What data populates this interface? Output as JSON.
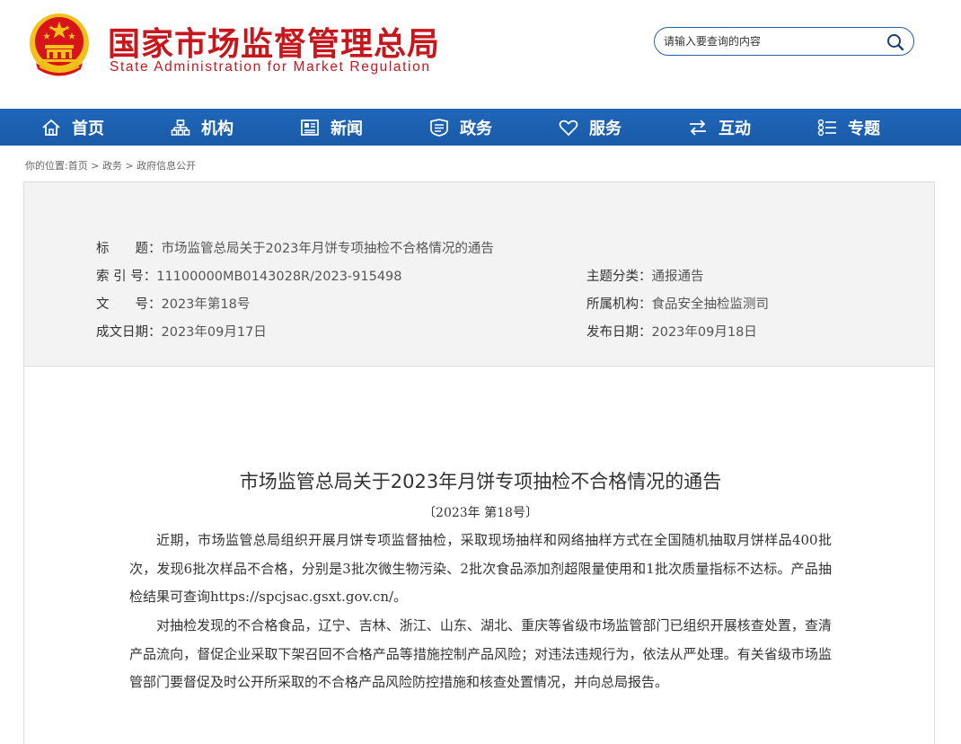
{
  "header": {
    "title_cn": "国家市场监督管理总局",
    "title_en": "State Administration for Market Regulation",
    "emblem_icon": "national-emblem-icon",
    "search_placeholder": "请输入要查询的内容",
    "search_icon": "search-icon"
  },
  "nav": {
    "items": [
      {
        "label": "首页",
        "icon": "home-icon"
      },
      {
        "label": "机构",
        "icon": "org-icon"
      },
      {
        "label": "新闻",
        "icon": "news-icon"
      },
      {
        "label": "政务",
        "icon": "affairs-icon"
      },
      {
        "label": "服务",
        "icon": "heart-icon"
      },
      {
        "label": "互动",
        "icon": "exchange-icon"
      },
      {
        "label": "专题",
        "icon": "topics-icon"
      }
    ]
  },
  "breadcrumb": {
    "prefix": "你的位置:",
    "items": [
      "首页",
      "政务",
      "政府信息公开"
    ],
    "separator": ">"
  },
  "meta": {
    "title_label": "标　　题：",
    "title_value": "市场监管总局关于2023年月饼专项抽检不合格情况的通告",
    "index_label": "索 引 号：",
    "index_value": "11100000MB0143028R/2023-915498",
    "topic_label": "主题分类：",
    "topic_value": "通报通告",
    "docno_label": "文　　号：",
    "docno_value": "2023年第18号",
    "org_label": "所属机构：",
    "org_value": "食品安全抽检监测司",
    "created_label": "成文日期：",
    "created_value": "2023年09月17日",
    "published_label": "发布日期：",
    "published_value": "2023年09月18日"
  },
  "article": {
    "title": "市场监管总局关于2023年月饼专项抽检不合格情况的通告",
    "number": "〔2023年 第18号〕",
    "paragraphs": [
      "近期，市场监管总局组织开展月饼专项监督抽检，采取现场抽样和网络抽样方式在全国随机抽取月饼样品400批次，发现6批次样品不合格，分别是3批次微生物污染、2批次食品添加剂超限量使用和1批次质量指标不达标。产品抽检结果可查询https://spcjsac.gsxt.gov.cn/。",
      "对抽检发现的不合格食品，辽宁、吉林、浙江、山东、湖北、重庆等省级市场监管部门已组织开展核查处置，查清产品流向，督促企业采取下架召回不合格产品等措施控制产品风险；对违法违规行为，依法从严处理。有关省级市场监管部门要督促及时公开所采取的不合格产品风险防控措施和核查处置情况，并向总局报告。"
    ]
  },
  "colors": {
    "brand_red": "#c8161d",
    "nav_blue": "#1d62b2",
    "emblem_gold": "#f3c219"
  }
}
